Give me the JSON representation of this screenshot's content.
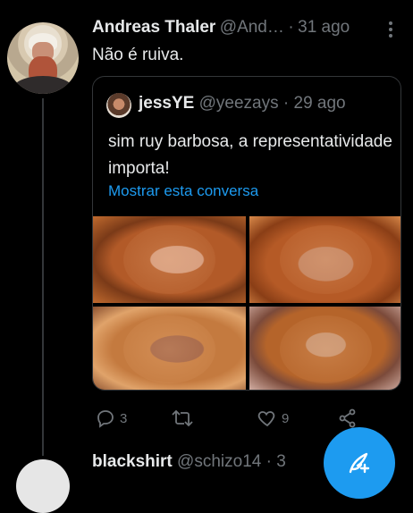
{
  "tweet": {
    "author_name": "Andreas Thaler",
    "author_handle": "@And…",
    "separator": "·",
    "time": "31 ago",
    "text": "Não é ruiva.",
    "actions": {
      "reply_count": "3",
      "retweet_count": "",
      "like_count": "9"
    }
  },
  "quoted_tweet": {
    "author_name": "jessYE",
    "author_handle": "@yeezays",
    "separator": "·",
    "time": "29 ago",
    "text": "sim ruy barbosa, a representatividade importa!",
    "show_thread_link": "Mostrar esta conversa",
    "photos": [
      "photo-1",
      "photo-2",
      "photo-3",
      "photo-4"
    ]
  },
  "next_tweet": {
    "author_name": "blackshirt",
    "author_handle": "@schizo14",
    "separator": "·",
    "time": "3"
  },
  "icons": {
    "more": "more-vertical-icon",
    "reply": "reply-icon",
    "retweet": "retweet-icon",
    "like": "heart-icon",
    "share": "share-icon",
    "compose": "compose-icon"
  },
  "colors": {
    "background": "#000000",
    "text": "#e7e9ea",
    "muted": "#71767b",
    "accent": "#1d9bf0",
    "border": "#333639"
  }
}
